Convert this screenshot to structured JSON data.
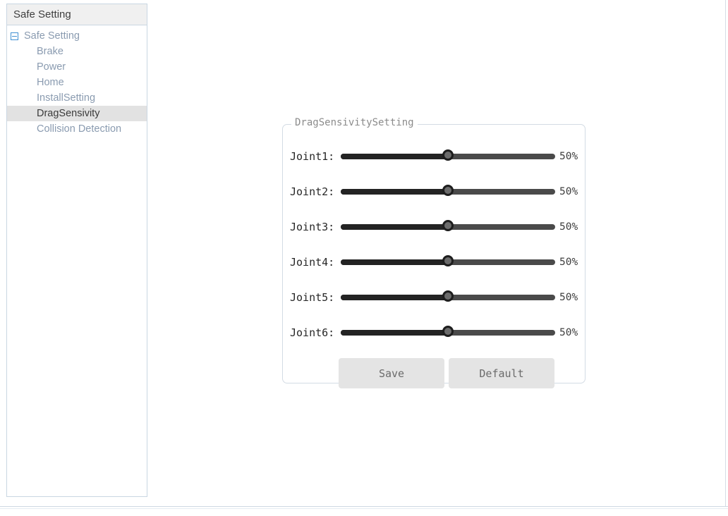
{
  "window": {
    "background": "#ffffff",
    "border_color": "#d5dde5"
  },
  "sidebar": {
    "header": "Safe Setting",
    "tree": {
      "expander_icon": "collapse-minus-icon",
      "root": {
        "label": "Safe Setting",
        "expanded": true
      },
      "items": [
        {
          "label": "Brake",
          "selected": false
        },
        {
          "label": "Power",
          "selected": false
        },
        {
          "label": "Home",
          "selected": false
        },
        {
          "label": "InstallSetting",
          "selected": false
        },
        {
          "label": "DragSensivity",
          "selected": true
        },
        {
          "label": "Collision Detection",
          "selected": false
        }
      ]
    },
    "colors": {
      "item_text": "#8a9bb0",
      "selected_bg": "#e2e2e2",
      "selected_text": "#3a3a3a",
      "expander_accent": "#3f8fd2"
    }
  },
  "main": {
    "groupbox": {
      "title": "DragSensivitySetting",
      "border_color": "#d3dbe4"
    },
    "sliders": [
      {
        "label": "Joint1:",
        "value": 50,
        "value_text": "50%",
        "min": 0,
        "max": 100
      },
      {
        "label": "Joint2:",
        "value": 50,
        "value_text": "50%",
        "min": 0,
        "max": 100
      },
      {
        "label": "Joint3:",
        "value": 50,
        "value_text": "50%",
        "min": 0,
        "max": 100
      },
      {
        "label": "Joint4:",
        "value": 50,
        "value_text": "50%",
        "min": 0,
        "max": 100
      },
      {
        "label": "Joint5:",
        "value": 50,
        "value_text": "50%",
        "min": 0,
        "max": 100
      },
      {
        "label": "Joint6:",
        "value": 50,
        "value_text": "50%",
        "min": 0,
        "max": 100
      }
    ],
    "buttons": {
      "save_label": "Save",
      "default_label": "Default",
      "background": "#e4e4e4",
      "text_color": "#6b6b6b"
    }
  }
}
